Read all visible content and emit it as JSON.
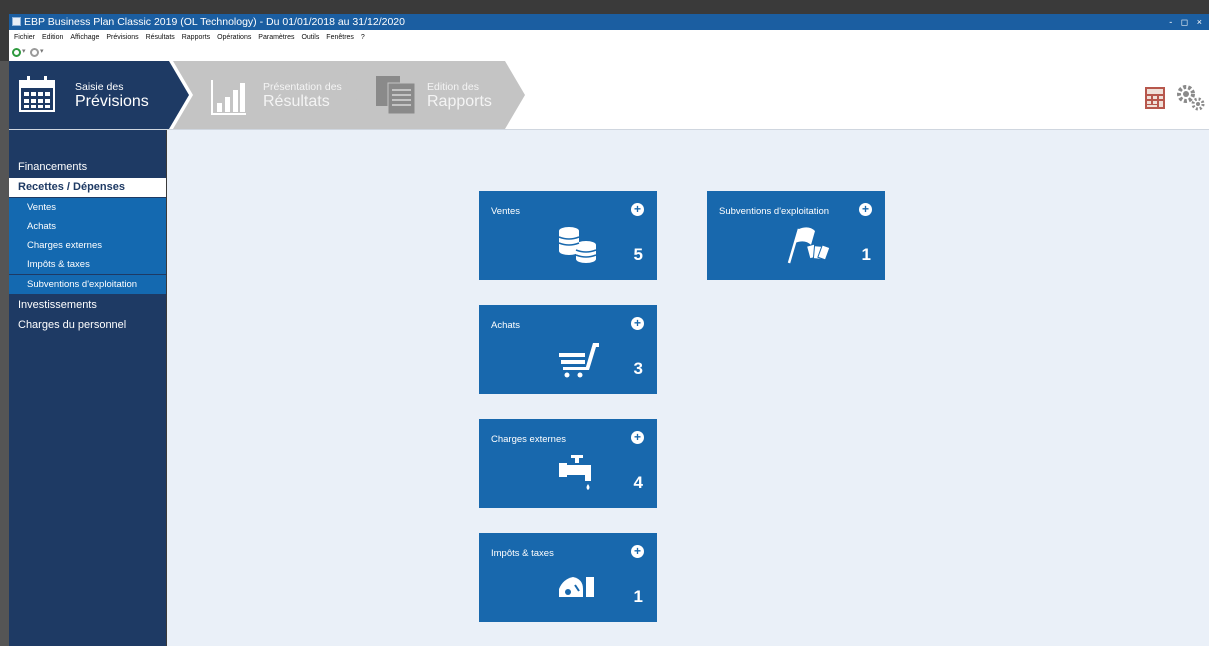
{
  "window": {
    "title": "EBP Business Plan Classic 2019 (OL Technology) - Du 01/01/2018 au 31/12/2020",
    "controls": "- ◻ ×"
  },
  "menu": [
    "Fichier",
    "Edition",
    "Affichage",
    "Prévisions",
    "Résultats",
    "Rapports",
    "Opérations",
    "Paramètres",
    "Outils",
    "Fenêtres",
    "?"
  ],
  "toolbar": {
    "icons": [
      "add-icon",
      "refresh-icon"
    ]
  },
  "steps": [
    {
      "small": "Saisie des",
      "big": "Prévisions",
      "state": "active"
    },
    {
      "small": "Présentation des",
      "big": "Résultats",
      "state": "inactive"
    },
    {
      "small": "Edition des",
      "big": "Rapports",
      "state": "inactive"
    }
  ],
  "sidebar": {
    "items": [
      {
        "label": "Financements"
      },
      {
        "label": "Recettes / Dépenses"
      },
      {
        "label": "Ventes"
      },
      {
        "label": "Achats"
      },
      {
        "label": "Charges externes"
      },
      {
        "label": "Impôts & taxes"
      },
      {
        "label": "Subventions d'exploitation"
      },
      {
        "label": "Investissements"
      },
      {
        "label": "Charges du personnel"
      }
    ]
  },
  "tiles": [
    {
      "label": "Ventes",
      "count": "5",
      "icon": "coins-icon"
    },
    {
      "label": "Subventions d'exploitation",
      "count": "1",
      "icon": "flag-money-icon"
    },
    {
      "label": "Achats",
      "count": "3",
      "icon": "cart-icon"
    },
    {
      "label": "Charges externes",
      "count": "4",
      "icon": "faucet-icon"
    },
    {
      "label": "Impôts & taxes",
      "count": "1",
      "icon": "tax-icon"
    }
  ],
  "colors": {
    "navy": "#1e3a64",
    "tile": "#1868ad",
    "sub": "#1469b0",
    "content": "#eaf0f8"
  }
}
